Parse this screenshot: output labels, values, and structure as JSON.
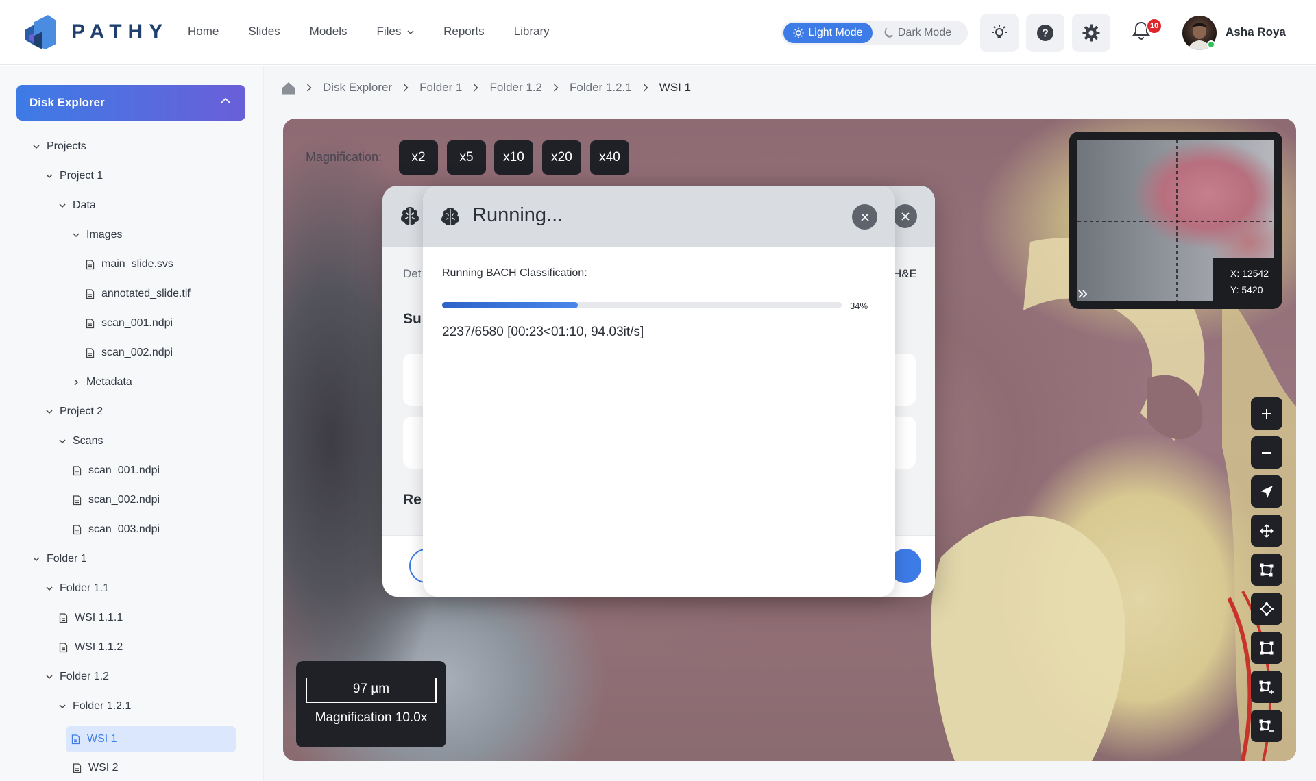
{
  "app": {
    "brand": "PATHY",
    "accent": "#3d7be6"
  },
  "nav": {
    "items": [
      "Home",
      "Slides",
      "Models",
      "Files",
      "Reports",
      "Library"
    ]
  },
  "mode": {
    "light": "Light Mode",
    "dark": "Dark Mode",
    "active": "light"
  },
  "header_icons": [
    "lightbulb-icon",
    "help-icon",
    "settings-icon",
    "bell-icon"
  ],
  "notifications": {
    "count": "10"
  },
  "user": {
    "name": "Asha Roya",
    "status_color": "#2fc15b"
  },
  "sidebar": {
    "title": "Disk Explorer",
    "tree": [
      {
        "label": "Projects",
        "type": "folder",
        "open": true
      },
      {
        "label": "Project 1",
        "type": "folder",
        "open": true
      },
      {
        "label": "Data",
        "type": "folder",
        "open": true
      },
      {
        "label": "Images",
        "type": "folder",
        "open": true
      },
      {
        "label": "main_slide.svs",
        "type": "file"
      },
      {
        "label": "annotated_slide.tif",
        "type": "file"
      },
      {
        "label": "scan_001.ndpi",
        "type": "file"
      },
      {
        "label": "scan_002.ndpi",
        "type": "file"
      },
      {
        "label": "Metadata",
        "type": "folder",
        "open": false
      },
      {
        "label": "Project 2",
        "type": "folder",
        "open": true
      },
      {
        "label": "Scans",
        "type": "folder",
        "open": true
      },
      {
        "label": "scan_001.ndpi",
        "type": "file"
      },
      {
        "label": "scan_002.ndpi",
        "type": "file"
      },
      {
        "label": "scan_003.ndpi",
        "type": "file"
      },
      {
        "label": "Folder 1",
        "type": "folder",
        "open": true
      },
      {
        "label": "Folder 1.1",
        "type": "folder",
        "open": true
      },
      {
        "label": "WSI 1.1.1",
        "type": "file"
      },
      {
        "label": "WSI 1.1.2",
        "type": "file"
      },
      {
        "label": "Folder 1.2",
        "type": "folder",
        "open": true
      },
      {
        "label": "Folder 1.2.1",
        "type": "folder",
        "open": true
      },
      {
        "label": "WSI 1",
        "type": "file",
        "selected": true
      },
      {
        "label": "WSI 2",
        "type": "file"
      }
    ]
  },
  "breadcrumb": [
    "Disk Explorer",
    "Folder 1",
    "Folder 1.2",
    "Folder 1.2.1",
    "WSI 1"
  ],
  "viewer": {
    "magnification_label": "Magnification:",
    "magnifications": [
      "x2",
      "x5",
      "x10",
      "x20",
      "x40"
    ],
    "minimap": {
      "x": "X: 12542",
      "y": "Y: 5420"
    },
    "scale": {
      "length": "97 µm",
      "magnification": "Magnification 10.0x"
    },
    "tools": [
      "zoom-in-icon",
      "zoom-out-icon",
      "navigate-icon",
      "pan-icon",
      "polygon-tool-icon",
      "point-tool-icon",
      "rectangle-tool-icon",
      "add-region-icon",
      "remove-region-icon"
    ]
  },
  "back_dialog": {
    "fragments": [
      "Det",
      "Su",
      "Re",
      "H&E"
    ]
  },
  "dialog": {
    "title": "Running...",
    "task": "Running BACH Classification:",
    "progress": 0.34,
    "progress_text": "34%",
    "stats": "2237/6580 [00:23<01:10, 94.03it/s]"
  }
}
